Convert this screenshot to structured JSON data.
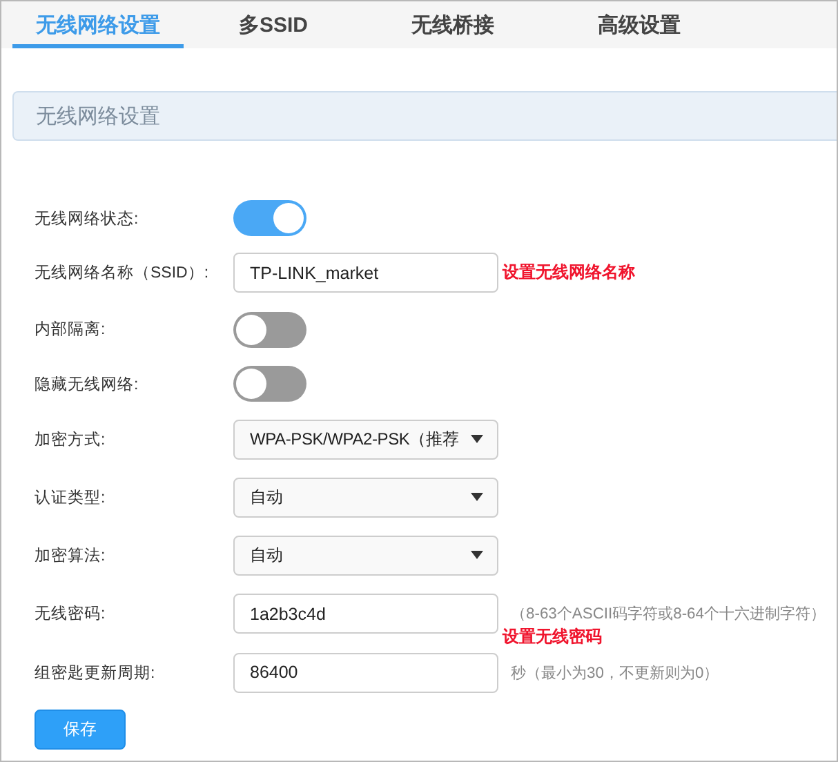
{
  "tabs": [
    {
      "label": "无线网络设置",
      "selected": true
    },
    {
      "label": "多SSID",
      "selected": false
    },
    {
      "label": "无线桥接",
      "selected": false
    },
    {
      "label": "高级设置",
      "selected": false
    }
  ],
  "section_title": "无线网络设置",
  "fields": [
    {
      "kind": "toggle",
      "label": "无线网络状态:",
      "on": true
    },
    {
      "kind": "text",
      "label": "无线网络名称（SSID）:",
      "value": "TP-LINK_market",
      "annotation": "设置无线网络名称"
    },
    {
      "kind": "toggle",
      "label": "内部隔离:",
      "on": false
    },
    {
      "kind": "toggle",
      "label": "隐藏无线网络:",
      "on": false
    },
    {
      "kind": "select",
      "label": "加密方式:",
      "value": "WPA-PSK/WPA2-PSK（推荐"
    },
    {
      "kind": "select",
      "label": "认证类型:",
      "value": "自动"
    },
    {
      "kind": "select",
      "label": "加密算法:",
      "value": "自动"
    },
    {
      "kind": "text",
      "label": "无线密码:",
      "value": "1a2b3c4d",
      "hint": "（8-63个ASCII码字符或8-64个十六进制字符）",
      "annotation": "设置无线密码"
    },
    {
      "kind": "text",
      "label": "组密匙更新周期:",
      "value": "86400",
      "hint": "秒（最小为30，不更新则为0）"
    }
  ],
  "save_button": "保存"
}
